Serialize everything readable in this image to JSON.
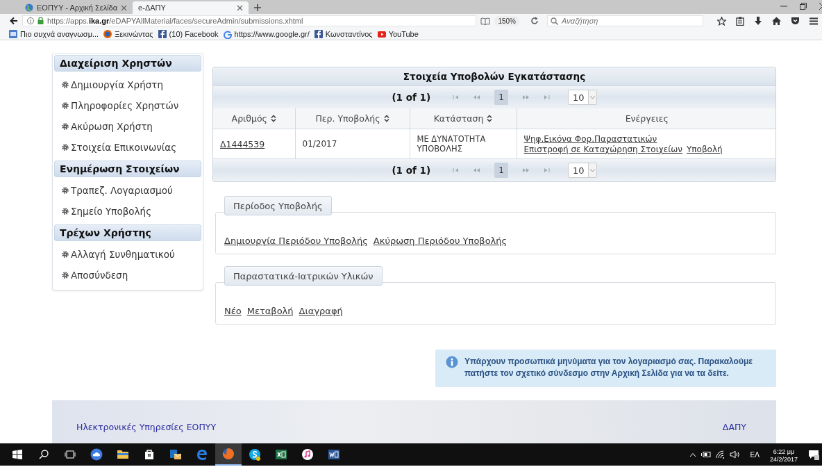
{
  "browser": {
    "tabs": [
      {
        "title": "ΕΟΠΥΥ - Αρχική Σελίδα",
        "selected": false
      },
      {
        "title": "e-ΔΑΠΥ",
        "selected": true
      }
    ],
    "url": "https://apps.**ika.gr**/eDAPYAllMaterial/faces/secureAdmin/submissions.xhtml",
    "zoom": "150%",
    "search": {
      "placeholder": "Αναζήτηση"
    },
    "bookmarks": [
      {
        "kind": "page",
        "label": "Πιο συχνά αναγνωσμ..."
      },
      {
        "kind": "firefox",
        "label": "Ξεκινώντας"
      },
      {
        "kind": "facebook",
        "label": "(10) Facebook"
      },
      {
        "kind": "google",
        "label": "https://www.google.gr/"
      },
      {
        "kind": "facebook",
        "label": "Κωνσταντίνος"
      },
      {
        "kind": "youtube",
        "label": "YouTube"
      }
    ]
  },
  "sidebar": {
    "sections": [
      {
        "title": "Διαχείριση Χρηστών",
        "items": [
          "Δημιουργία Χρήστη",
          "Πληροφορίες Χρηστών",
          "Ακύρωση Χρήστη",
          "Στοιχεία Επικοινωνίας"
        ]
      },
      {
        "title": "Ενημέρωση Στοιχείων",
        "items": [
          "Τραπεζ. Λογαριασμού",
          "Σημείο Υποβολής"
        ]
      },
      {
        "title": "Τρέχων Χρήστης",
        "items": [
          "Αλλαγή Συνθηματικού",
          "Αποσύνδεση"
        ]
      }
    ]
  },
  "table": {
    "title": "Στοιχεία Υποβολών Εγκατάστασης",
    "paginators": [
      {
        "summary": "(1 of 1)",
        "pages": [
          {
            "label": "1",
            "selected": true
          }
        ],
        "rows_per_page": "10"
      },
      {
        "summary": "(1 of 1)",
        "pages": [
          {
            "label": "1",
            "selected": true
          }
        ],
        "rows_per_page": "10"
      }
    ],
    "columns": [
      {
        "label": "Αριθμός",
        "sortable": true
      },
      {
        "label": "Περ. Υποβολής",
        "sortable": true
      },
      {
        "label": "Κατάσταση",
        "sortable": true
      },
      {
        "label": "Ενέργειες",
        "sortable": false
      }
    ],
    "rows": [
      {
        "number": "Δ1444539",
        "period": "01/2017",
        "status": "ΜΕ ΔΥΝΑΤΟΤΗΤΑ ΥΠΟΒΟΛΗΣ",
        "actions": [
          "Ψηφ.Εικόνα Φορ.Παραστατικών",
          "Επιστροφή σε Καταχώρηση Στοιχείων",
          "Υποβολή"
        ]
      }
    ]
  },
  "panels": [
    {
      "legend": "Περίοδος Υποβολής",
      "links": [
        "Δημιουργία Περιόδου Υποβολής",
        "Ακύρωση Περιόδου Υποβολής"
      ]
    },
    {
      "legend": "Παραστατικά-Ιατρικών Υλικών",
      "links": [
        "Νέο",
        "Μεταβολή",
        "Διαγραφή"
      ]
    }
  ],
  "info_message": "Υπάρχουν προσωπικά μηνύματα για τον λογαριασμό σας. Παρακαλούμε πατήστε τον σχετικό σύνδεσμο στην Αρχική Σελίδα για να τα δείτε.",
  "footer": {
    "title": "Ηλεκτρονικές Υπηρεσίες ΕΟΠΥΥ",
    "link": "ΔΑΠΥ"
  },
  "taskbar": {
    "apps": [
      {
        "kind": "cloud",
        "active": false
      },
      {
        "kind": "folder",
        "active": false
      },
      {
        "kind": "store",
        "active": false
      },
      {
        "kind": "mail",
        "active": false
      },
      {
        "kind": "edge",
        "active": false
      },
      {
        "kind": "firefox",
        "active": true
      },
      {
        "kind": "skype",
        "active": false
      },
      {
        "kind": "excel",
        "active": false
      },
      {
        "kind": "music",
        "active": false
      },
      {
        "kind": "word",
        "active": false
      }
    ],
    "language": "ΕΛ",
    "time": "6:22 μμ",
    "date": "24/2/2017"
  }
}
